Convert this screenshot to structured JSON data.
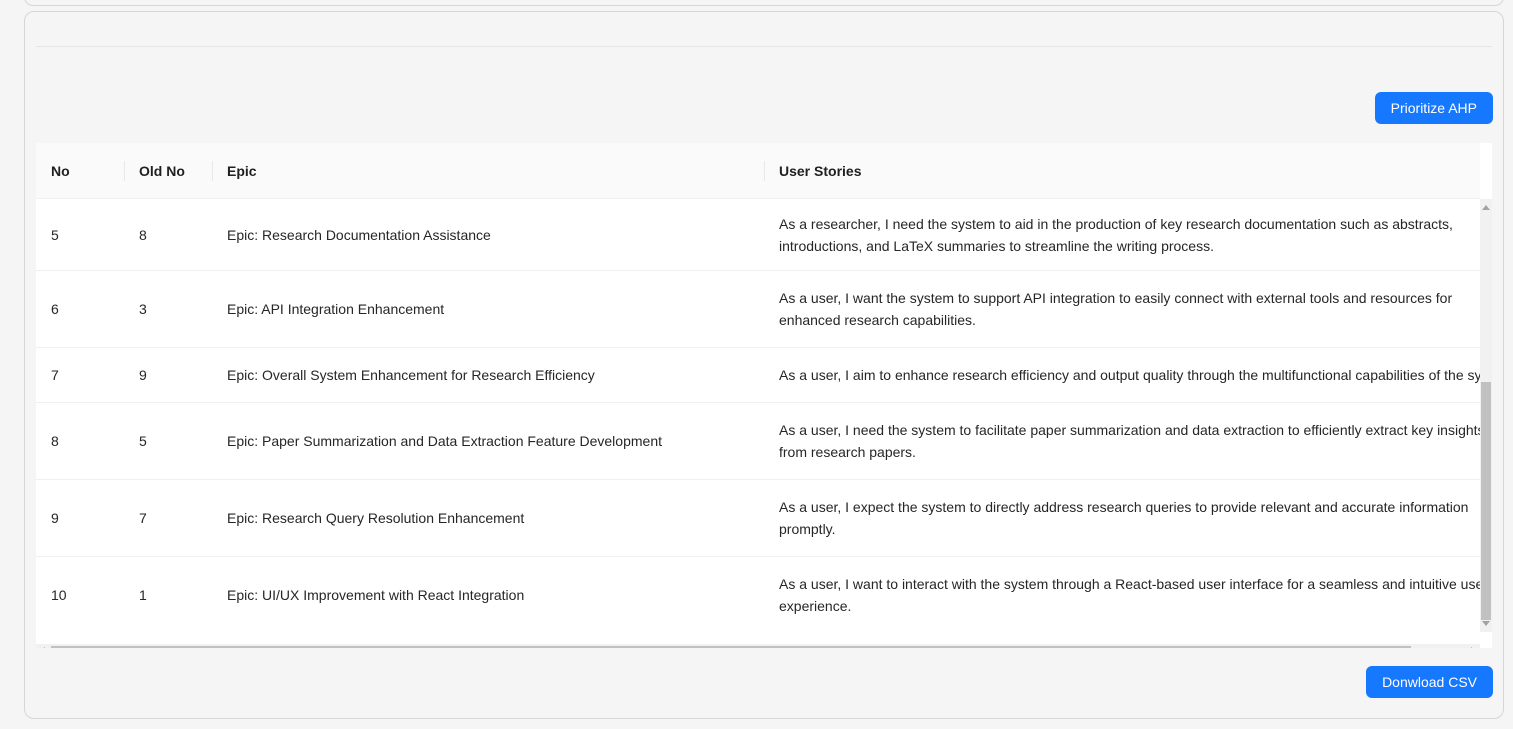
{
  "actions": {
    "prioritize_label": "Prioritize AHP",
    "download_label": "Donwload CSV"
  },
  "table": {
    "headers": {
      "no": "No",
      "old_no": "Old No",
      "epic": "Epic",
      "user_stories": "User Stories"
    },
    "rows": [
      {
        "no": "5",
        "old_no": "8",
        "epic": "Epic: Research Documentation Assistance",
        "story": "As a researcher, I need the system to aid in the production of key research documentation such as abstracts, introductions, and LaTeX summaries to streamline the writing process."
      },
      {
        "no": "6",
        "old_no": "3",
        "epic": "Epic: API Integration Enhancement",
        "story": "As a user, I want the system to support API integration to easily connect with external tools and resources for enhanced research capabilities."
      },
      {
        "no": "7",
        "old_no": "9",
        "epic": "Epic: Overall System Enhancement for Research Efficiency",
        "story": "As a user, I aim to enhance research efficiency and output quality through the multifunctional capabilities of the system."
      },
      {
        "no": "8",
        "old_no": "5",
        "epic": "Epic: Paper Summarization and Data Extraction Feature Development",
        "story": "As a user, I need the system to facilitate paper summarization and data extraction to efficiently extract key insights from research papers."
      },
      {
        "no": "9",
        "old_no": "7",
        "epic": "Epic: Research Query Resolution Enhancement",
        "story": "As a user, I expect the system to directly address research queries to provide relevant and accurate information promptly."
      },
      {
        "no": "10",
        "old_no": "1",
        "epic": "Epic: UI/UX Improvement with React Integration",
        "story": "As a user, I want to interact with the system through a React-based user interface for a seamless and intuitive user experience."
      }
    ]
  }
}
